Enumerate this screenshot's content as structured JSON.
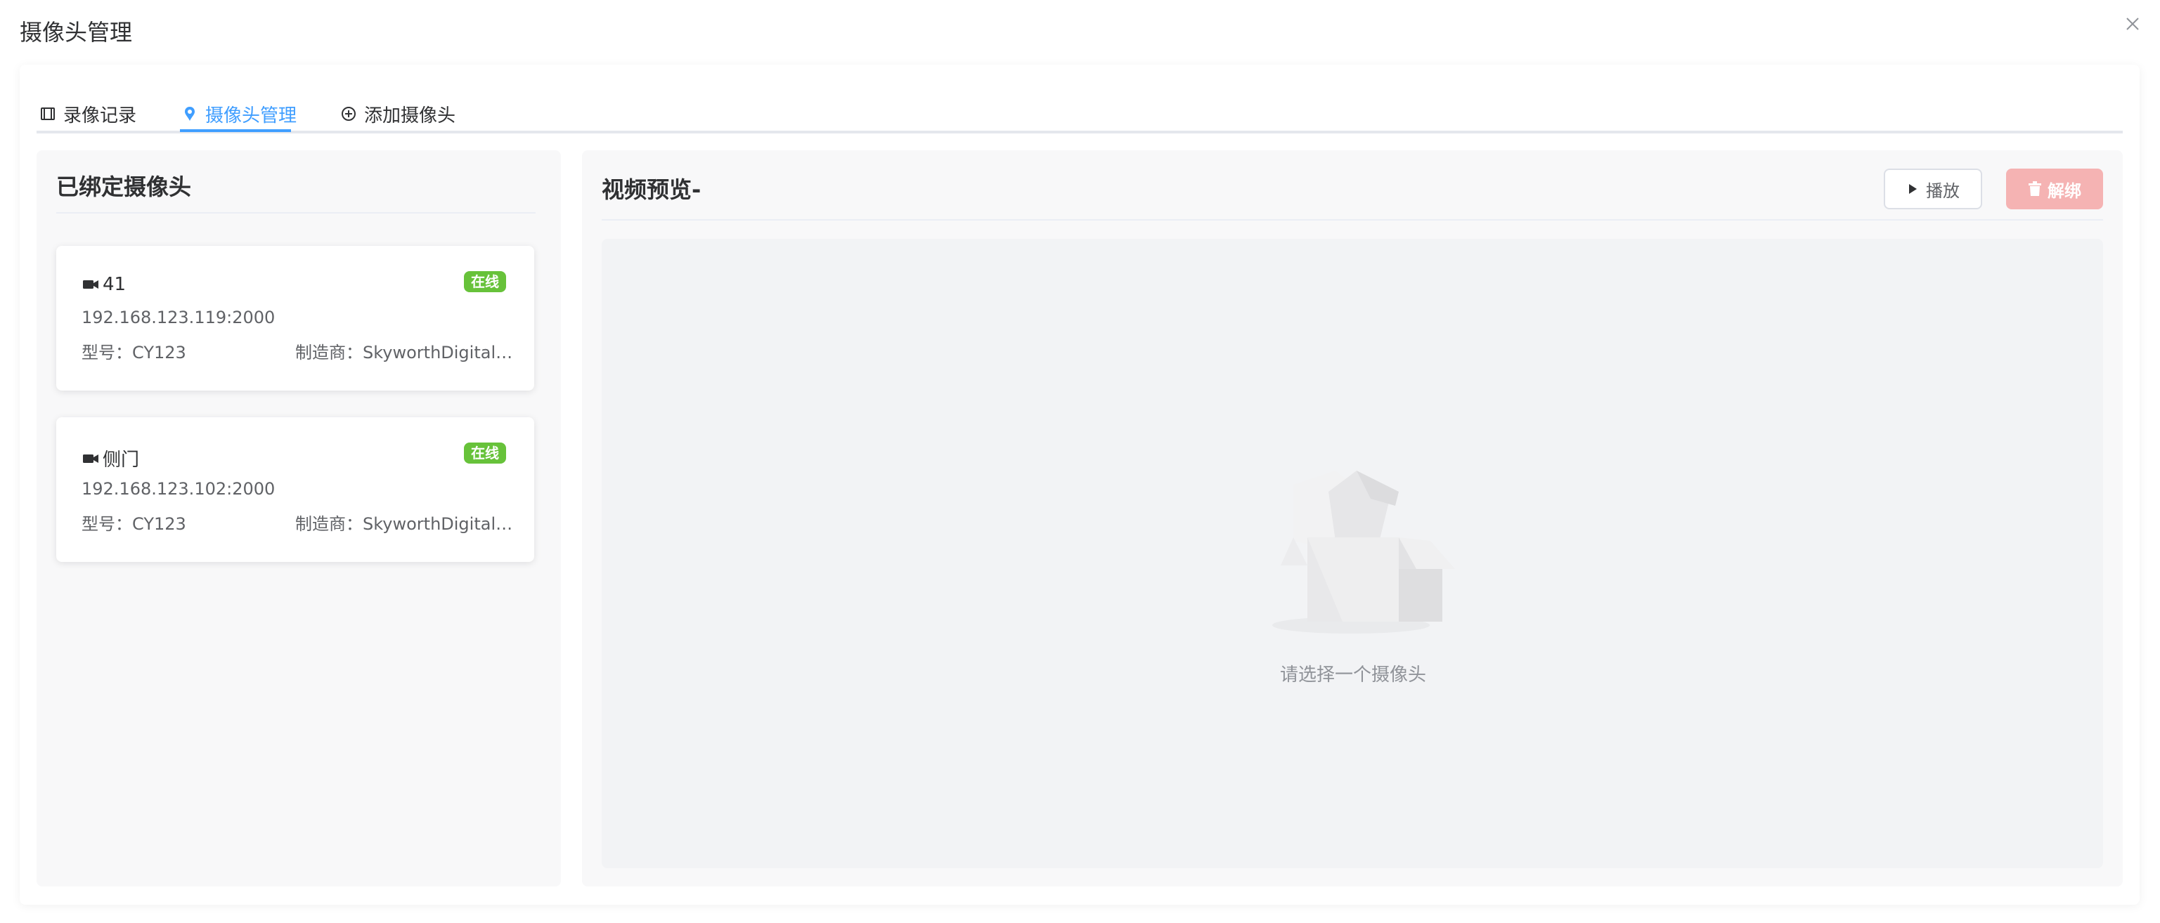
{
  "dialog": {
    "title": "摄像头管理"
  },
  "tabs": [
    {
      "label": "录像记录",
      "icon": "film-icon",
      "active": false
    },
    {
      "label": "摄像头管理",
      "icon": "camera-pin-icon",
      "active": true
    },
    {
      "label": "添加摄像头",
      "icon": "plus-circle-icon",
      "active": false
    }
  ],
  "left": {
    "title": "已绑定摄像头",
    "cameras": [
      {
        "name": "41",
        "status": "在线",
        "address": "192.168.123.119:2000",
        "model": "型号：CY123",
        "maker": "制造商：SkyworthDigitalTechnology"
      },
      {
        "name": "侧门",
        "status": "在线",
        "address": "192.168.123.102:2000",
        "model": "型号：CY123",
        "maker": "制造商：SkyworthDigitalTechnology"
      }
    ]
  },
  "right": {
    "title": "视频预览-",
    "play_label": "播放",
    "unbind_label": "解绑",
    "empty_text": "请选择一个摄像头"
  },
  "colors": {
    "accent": "#409eff",
    "online": "#67c23a",
    "danger_disabled": "#f5b3b3"
  }
}
